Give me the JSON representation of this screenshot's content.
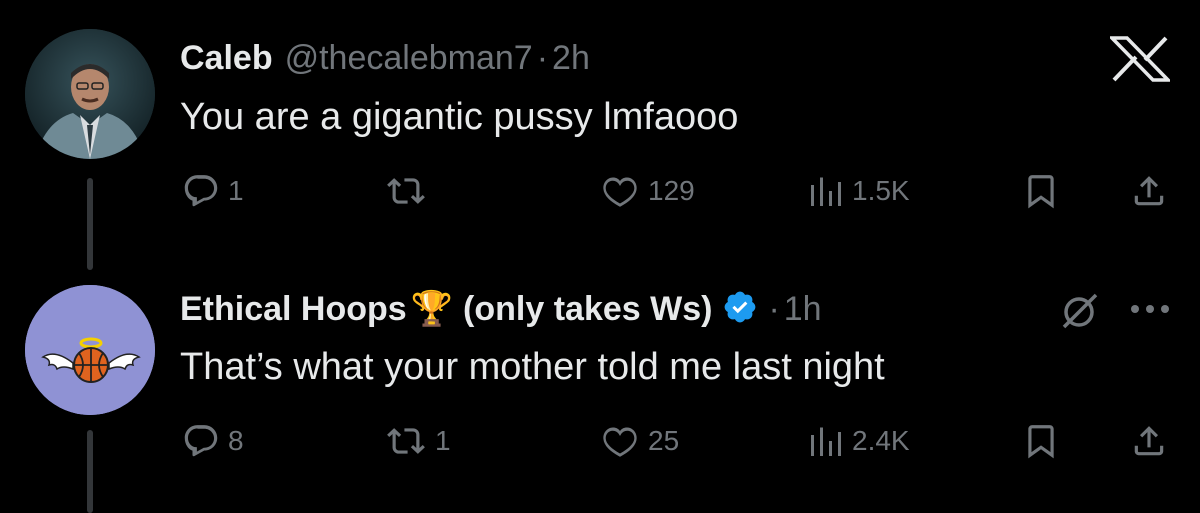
{
  "tweets": [
    {
      "name": "Caleb",
      "handle": "@thecalebman7",
      "time": "2h",
      "text": "You are a gigantic pussy lmfaooo",
      "replies": "1",
      "retweets": "",
      "likes": "129",
      "views": "1.5K"
    },
    {
      "name": "Ethical Hoops",
      "name_suffix": "(only takes Ws)",
      "emoji": "🏆",
      "time": "1h",
      "text": "That’s what your mother told me last night",
      "replies": "8",
      "retweets": "1",
      "likes": "25",
      "views": "2.4K"
    }
  ],
  "separator": "·",
  "icons": {
    "top_corner": "x-logo-icon",
    "second_corner": "grok-slash-icon",
    "more": "more-horizontal-icon"
  },
  "colors": {
    "background": "#000000",
    "text": "#e7e9ea",
    "muted": "#71767b",
    "verified": "#1d9bf0",
    "avatar2_bg": "#8f92d4"
  }
}
